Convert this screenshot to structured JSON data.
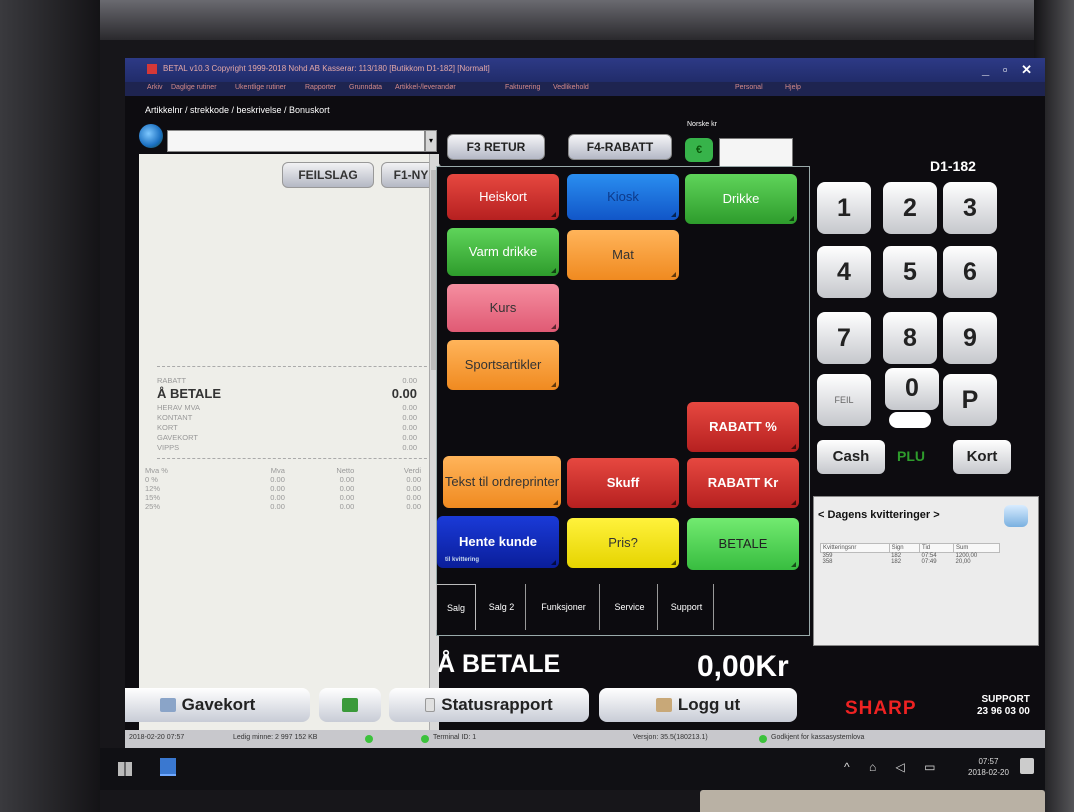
{
  "app": {
    "title": "BETAL v10.3 Copyright 1999-2018 Nohd AB  Kasserar: 113/180 [Butikkom D1-182]  [Normalt]",
    "menu": [
      "Arkiv",
      "Daglige rutiner",
      "Ukentlige rutiner",
      "Rapporter",
      "Grunndata",
      "Artikkel-/leverandør",
      "Fakturering",
      "Vedlikehold",
      "Personal",
      "Hjelp"
    ],
    "window_controls": "_ ▫ ✕"
  },
  "left": {
    "article_label": "Artikkelnr / strekkode / beskrivelse / Bonuskort",
    "search_value": "",
    "feilslag_label": "FEILSLAG",
    "f1ny_label": "F1-NY",
    "summary": [
      {
        "label": "RABATT",
        "value": "0.00"
      },
      {
        "label": "Å BETALE",
        "value": "0.00"
      },
      {
        "label": "HERAV MVA",
        "value": "0.00"
      },
      {
        "label": "KONTANT",
        "value": "0.00"
      },
      {
        "label": "KORT",
        "value": "0.00"
      },
      {
        "label": "GAVEKORT",
        "value": "0.00"
      },
      {
        "label": "VIPPS",
        "value": "0.00"
      }
    ],
    "mva_headers": [
      "Mva %",
      "Mva",
      "Netto",
      "Verdi"
    ],
    "mva_rows": [
      [
        "0 %",
        "0.00",
        "0.00",
        "0.00"
      ],
      [
        "12%",
        "0.00",
        "0.00",
        "0.00"
      ],
      [
        "15%",
        "0.00",
        "0.00",
        "0.00"
      ],
      [
        "25%",
        "0.00",
        "0.00",
        "0.00"
      ]
    ]
  },
  "center": {
    "f3_label": "F3 RETUR",
    "f4_label": "F4-RABATT",
    "norske_label": "Norske kr",
    "coin_symbol": "€",
    "norske_value": "",
    "tiles": {
      "heiskort": "Heiskort",
      "kiosk": "Kiosk",
      "drikke": "Drikke",
      "varm_drikke": "Varm drikke",
      "mat": "Mat",
      "kurs": "Kurs",
      "sportsartikler": "Sportsartikler",
      "rabatt_pct": "RABATT %",
      "tekst_ordreprinter": "Tekst til ordreprinter",
      "skuff": "Skuff",
      "rabatt_kr": "RABATT Kr",
      "hente_kunde": "Hente kunde",
      "hente_kunde_sub": "til kvittering",
      "pris": "Pris?",
      "betale": "BETALE"
    },
    "tabs": [
      "Salg",
      "Salg 2",
      "Funksjoner",
      "Service",
      "Support"
    ],
    "total_label": "Å BETALE",
    "total_value": "0,00Kr"
  },
  "right": {
    "register_id": "D1-182",
    "keys": [
      "1",
      "2",
      "3",
      "4",
      "5",
      "6",
      "7",
      "8",
      "9",
      "FEIL",
      "0",
      "P"
    ],
    "cash_label": "Cash",
    "plu_label": "PLU",
    "kort_label": "Kort",
    "receipts_header": "< Dagens kvitteringer >",
    "receipt_headers": [
      "Kvitteringsnr",
      "Sign",
      "Tid",
      "Sum"
    ],
    "receipt_rows": [
      [
        "359",
        "182",
        "07:54",
        "1200,00"
      ],
      [
        "358",
        "182",
        "07:49",
        "20,00"
      ]
    ]
  },
  "bottom": {
    "gavekort_label": "Gavekort",
    "statusrapport_label": "Statusrapport",
    "logg_ut_label": "Logg ut",
    "brand": "SHARP",
    "support_line1": "SUPPORT",
    "support_line2": "23 96 03 00"
  },
  "statusbar": {
    "date_text": "2018-02-20  07:57",
    "ledig_text": "Ledig minne: 2 997 152 KB",
    "terminal_text": "Terminal ID: 1",
    "version_text": "Versjon: 35.5(180213.1)",
    "godkjent_text": "Godkjent for kassasystemlova"
  },
  "taskbar": {
    "time": "07:57",
    "date": "2018-02-20",
    "tray_icons": "^ ⌂ ◁ ▭"
  },
  "colors": {
    "red_tile": "#c92a2a",
    "blue_tile": "#1c70e0",
    "green_tile": "#3cb83a",
    "orange_tile": "#f59a30",
    "pink_tile": "#ea6f88",
    "navy_tile": "#0f28b8",
    "yellow_tile": "#f2e420",
    "brand_red": "#e22222"
  }
}
